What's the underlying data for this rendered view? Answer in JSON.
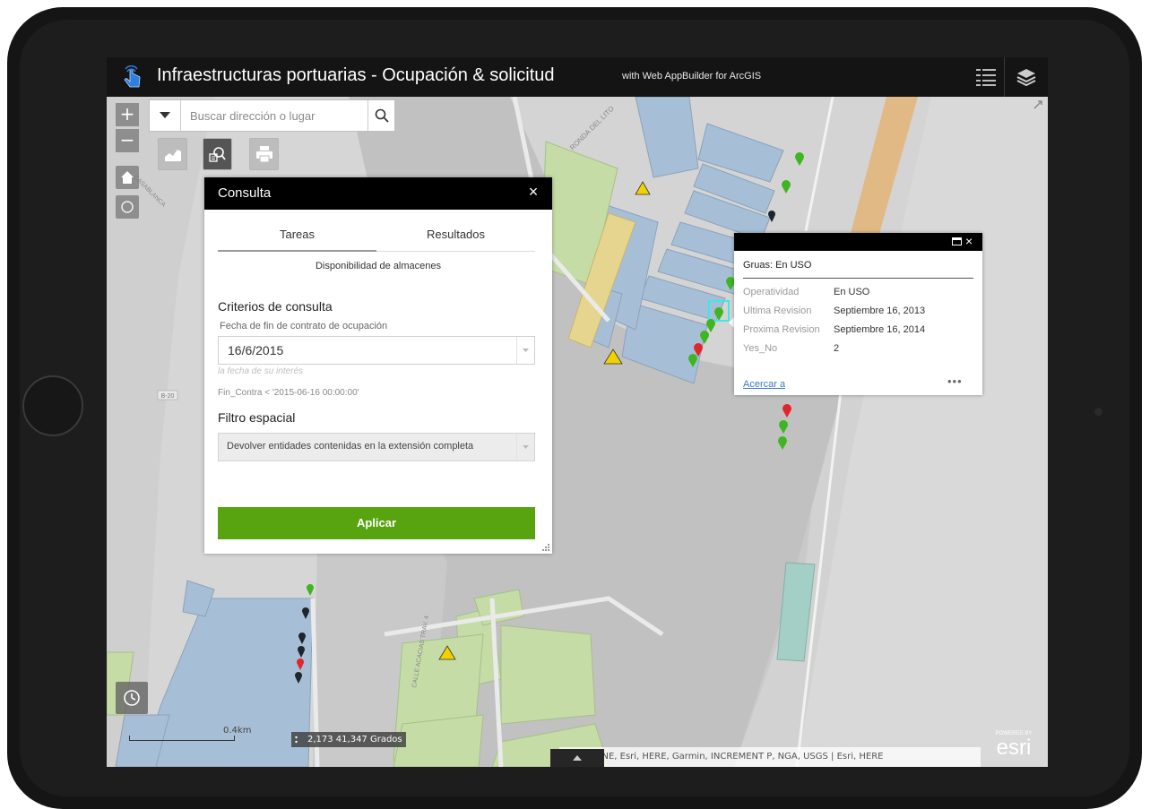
{
  "header": {
    "title": "Infraestructuras portuarias - Ocupación & solicitud",
    "subtitle": "with Web AppBuilder for ArcGIS",
    "icons": [
      "hand-pointer-icon",
      "legend-icon",
      "layers-icon"
    ]
  },
  "search": {
    "placeholder": "Buscar dirección o lugar"
  },
  "zoom": {
    "in_label": "+",
    "out_label": "−"
  },
  "toolbar": {
    "icons": [
      "chart-icon",
      "query-icon",
      "print-icon"
    ]
  },
  "query_panel": {
    "title": "Consulta",
    "close_label": "×",
    "tabs": [
      {
        "label": "Tareas",
        "active": true
      },
      {
        "label": "Resultados",
        "active": false
      }
    ],
    "task_name": "Disponibilidad de almacenes",
    "criteria_heading": "Criterios de consulta",
    "date_label": "Fecha de fin de contrato de ocupación",
    "date_value": "16/6/2015",
    "date_hint": "la fecha de su interés",
    "expression": "Fin_Contra < '2015-06-16 00:00:00'",
    "spatial_heading": "Filtro espacial",
    "spatial_value": "Devolver entidades contenidas en la extensión completa",
    "apply_label": "Aplicar"
  },
  "popup": {
    "title": "Gruas: En USO",
    "close_label": "×",
    "fields": [
      {
        "label": "Operatividad",
        "value": "En USO"
      },
      {
        "label": "Ultima Revision",
        "value": "Septiembre 16, 2013"
      },
      {
        "label": "Proxima Revision",
        "value": "Septiembre 16, 2014"
      },
      {
        "label": "Yes_No",
        "value": "2"
      }
    ],
    "zoom_link": "Acercar a",
    "more_label": "•••"
  },
  "map": {
    "road_label": "RONDA DEL LITO",
    "left_road_label": "CASABLANCA",
    "road_marker": "B-20",
    "road_label_bottom": "CALLE ACACIAS TRAV. 4",
    "scale_label": "0.4km",
    "coordinates": "2,173 41,347 Grados",
    "attribution": "IGN, INE, Esri, HERE, Garmin, INCREMENT P, NGA, USGS | Esri, HERE",
    "logo_text": "esri",
    "logo_caption": "POWERED BY",
    "colors": {
      "water": "#c9c9c9",
      "land": "#d7d7d7",
      "blue_area": "#a7bfd6",
      "green_area": "#c5dca6",
      "pin_green": "#3fb522",
      "pin_red": "#e0262b",
      "pin_black": "#222a33",
      "apply_green": "#58a410"
    }
  }
}
